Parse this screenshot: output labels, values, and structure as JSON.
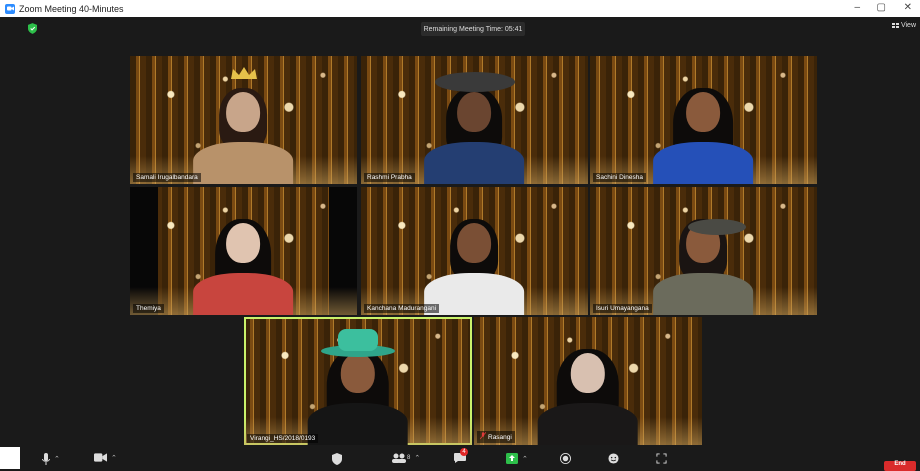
{
  "window": {
    "title": "Zoom Meeting 40-Minutes",
    "minimize": "–",
    "maximize": "▢",
    "close": "✕"
  },
  "meeting": {
    "timer_text": "Remaining Meeting Time: 05:41",
    "view_label": "View"
  },
  "participants": [
    {
      "name": "Samali Irugalbandara",
      "active": false,
      "muted": false
    },
    {
      "name": "Rashmi Prabha",
      "active": false,
      "muted": false
    },
    {
      "name": "Sachini Dinesha",
      "active": false,
      "muted": false
    },
    {
      "name": "Themiya",
      "active": false,
      "muted": false
    },
    {
      "name": "Kanchana Madurangani",
      "active": false,
      "muted": false
    },
    {
      "name": "Isuri Umayangana",
      "active": false,
      "muted": false
    },
    {
      "name": "Virangi_HS/2018/0193",
      "active": true,
      "muted": false
    },
    {
      "name": "Rasangi",
      "active": false,
      "muted": true
    }
  ],
  "toolbar": {
    "participants_count": "8",
    "chat_badge": "4",
    "end_label": "End"
  },
  "colors": {
    "accent_active": "#c9f26b",
    "end_button": "#d92b2b",
    "share_green": "#2dbf4a",
    "zoom_blue": "#2d8cff"
  }
}
